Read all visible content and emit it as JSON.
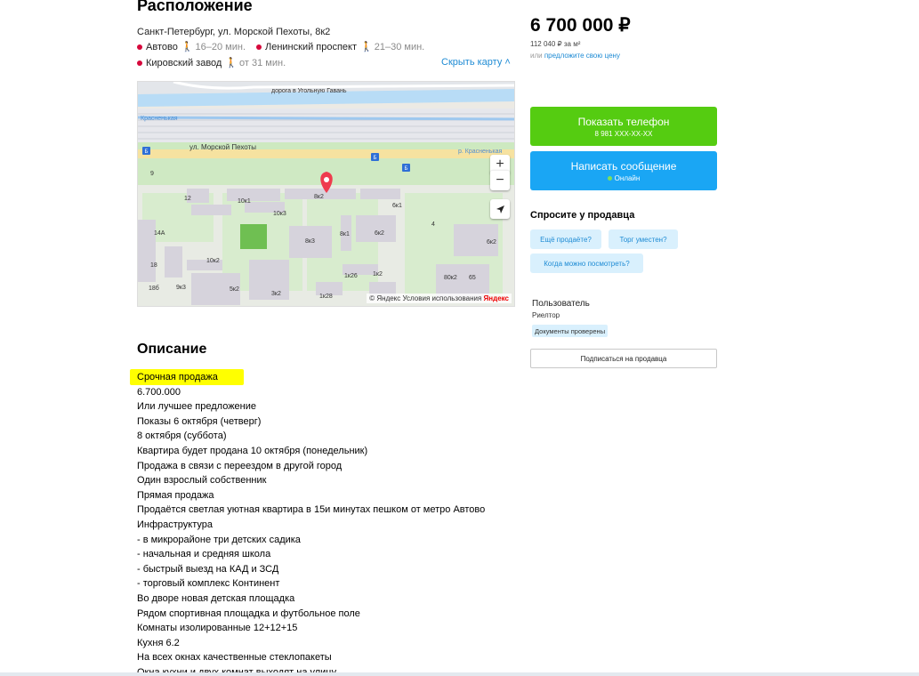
{
  "location": {
    "title": "Расположение",
    "address": "Санкт-Петербург, ул. Морской Пехоты, 8к2",
    "metro": [
      {
        "name": "Автово",
        "time": "16–20 мин.",
        "color": "#d6083b"
      },
      {
        "name": "Ленинский проспект",
        "time": "21–30 мин.",
        "color": "#d6083b"
      },
      {
        "name": "Кировский завод",
        "time": "от 31 мин.",
        "color": "#d6083b"
      }
    ],
    "hide_map": "Скрыть карту ˄"
  },
  "map": {
    "labels": {
      "road_top": "дорога в Угольную Гавань",
      "street": "ул. Морской Пехоты",
      "river_left": "Красненькая",
      "river_right": "р. Красненькая",
      "b12": "12",
      "b10k1": "10к1",
      "b8k2": "8к2",
      "b10k3": "10к3",
      "b8k3": "8к3",
      "b8k1": "8к1",
      "b6k1": "6к1",
      "b6k2": "6к2",
      "b4": "4",
      "b6k2b": "6к2",
      "b14a": "14А",
      "b10k2": "10к2",
      "b18": "18",
      "b9k3": "9к3",
      "b5k2": "5к2",
      "b3k2": "3к2",
      "b1k26": "1к26",
      "b1k2": "1к2",
      "b1k28": "1к28",
      "b18b": "18б",
      "b9": "9",
      "b80k2": "80к2",
      "b65": "65",
      "bus1": "Б",
      "bus2": "Б",
      "bus3": "Б",
      "bus4": "Б"
    },
    "zoom_in": "+",
    "zoom_out": "−",
    "copyright": "© Яндекс  Условия использования",
    "logo": "Яндекс"
  },
  "description": {
    "title": "Описание",
    "lines": [
      "Срочная продажа",
      "6.700.000",
      "Или лучшее предложение",
      "Показы 6 октября (четверг)",
      "8 октября (суббота)",
      "Квартира будет продана 10 октября (понедельник)",
      "Продажа в связи с переездом в другой город",
      "Один взрослый собственник",
      "Прямая продажа",
      "Продаётся светлая уютная квартира в 15и минутах пешком от метро Автово",
      "Инфраструктура",
      "- в микрорайоне три детских садика",
      "- начальная и средняя школа",
      "- быстрый выезд на КАД и ЗСД",
      "- торговый комплекс Континент",
      "Во дворе новая детская площадка",
      "Рядом спортивная площадка и футбольное поле",
      "Комнаты изолированные 12+12+15",
      "Кухня 6.2",
      "На всех окнах качественные стеклопакеты",
      "Окна кухни и двух комнат выходят на улицу"
    ],
    "highlight_color": "#ffff00"
  },
  "price": {
    "value": "6 700 000 ₽",
    "per_meter": "112 040 ₽ за м²",
    "offer_prefix": "или",
    "offer_link": "предложите свою цену"
  },
  "actions": {
    "show_phone": "Показать телефон",
    "phone_mask": "8 981 XXX-XX-XX",
    "send_message": "Написать сообщение",
    "online": "Онлайн",
    "green": "#55cc11",
    "blue": "#1aa6f4"
  },
  "ask": {
    "title": "Спросите у продавца",
    "chips": [
      "Ещё продаёте?",
      "Торг уместен?",
      "Когда можно посмотреть?"
    ]
  },
  "seller": {
    "name": "Пользователь",
    "role": "Риелтор",
    "badge": "Документы проверены",
    "subscribe": "Подписаться на продавца"
  }
}
